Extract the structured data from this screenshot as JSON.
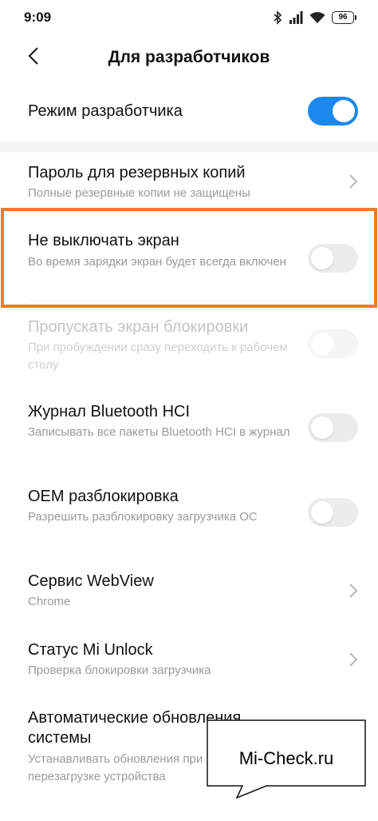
{
  "status": {
    "time": "9:09",
    "battery": "96"
  },
  "header": {
    "title": "Для разработчиков"
  },
  "rows": [
    {
      "title": "Режим разработчика",
      "toggle": "on"
    },
    {
      "title": "Пароль для резервных копий",
      "subtitle": "Полные резервные копии не защищены",
      "chevron": true
    },
    {
      "title": "Не выключать экран",
      "subtitle": "Во время зарядки экран будет всегда включен",
      "toggle": "off",
      "highlighted": true
    },
    {
      "title": "Пропускать экран блокировки",
      "subtitle": "При пробуждении сразу переходить к рабочем столу",
      "toggle": "off",
      "disabled": true
    },
    {
      "title": "Журнал Bluetooth HCI",
      "subtitle": "Записывать все пакеты Bluetooth HCI в журнал",
      "toggle": "off"
    },
    {
      "title": "OEM разблокировка",
      "subtitle": "Разрешить разблокировку загрузчика ОС",
      "toggle": "off"
    },
    {
      "title": "Сервис WebView",
      "subtitle": "Chrome",
      "chevron": true
    },
    {
      "title": "Статус Mi Unlock",
      "subtitle": "Проверка блокировки загрузчика",
      "chevron": true
    },
    {
      "title": "Автоматические обновления системы",
      "subtitle": "Устанавливать обновления при перезагрузке устройства"
    }
  ],
  "watermark": {
    "text": "Mi-Check.ru"
  },
  "colors": {
    "accent": "#1a88ec",
    "highlight": "#f37b20"
  }
}
